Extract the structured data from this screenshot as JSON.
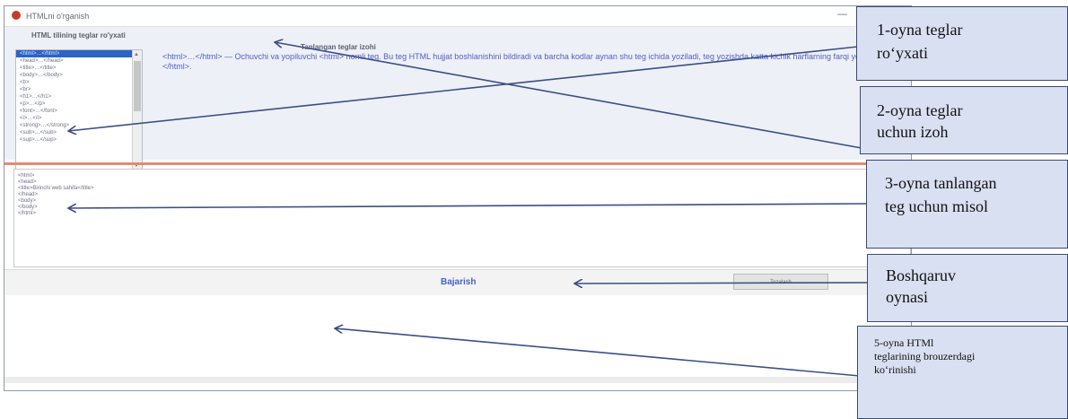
{
  "window": {
    "title": "HTMLni o'rganish",
    "minimize_label": "—"
  },
  "tag_list": {
    "label": "HTML tilining teglar ro'yxati",
    "items": [
      "<html>…</html>",
      "<head>…</head>",
      "<title>…</title>",
      "<body>…</body>",
      "<b>",
      "<br>",
      "<h1>…</h1>",
      "<p>…</p>",
      "<font>…</font>",
      "<i>…</i>",
      "<strong>…</strong>",
      "<sub>…</sub>",
      "<sup>…</sup>"
    ],
    "selected_index": 0
  },
  "comment": {
    "label": "Tanlangan teglar izohi",
    "text": "<html>…</html> — Ochuvchi va yopiluvchi <html> nomli teg. Bu teg HTML hujjat boshlanishini bildiradi va barcha kodlar aynan shu teg ichida yoziladi, teg yozishda katta kichik harflarning farqi yo'q <html>…</html>."
  },
  "code_example": {
    "lines": [
      "<html>",
      "<head>",
      "<title>Birinchi web sahifa</title>",
      "</head>",
      "<body>",
      "",
      "</body>",
      "</html>"
    ]
  },
  "controls": {
    "run_label": "Bajarish",
    "clear_label": "Tozalash"
  },
  "callouts": {
    "c1": [
      "1-oyna teglar",
      "ro‘yxati"
    ],
    "c2": [
      "2-oyna teglar",
      "uchun izoh"
    ],
    "c3": [
      "3-oyna tanlangan",
      "teg uchun misol"
    ],
    "c4": [
      "Boshqaruv",
      "oynasi"
    ],
    "c5": [
      "5-oyna HTMl",
      "teglarining brouzerdagi",
      "ko‘rinishi"
    ]
  },
  "colors": {
    "accent": "#4760c4",
    "callout_bg": "#d9e0f2",
    "arrow": "#3a4f86",
    "divider": "#e58a6e"
  }
}
